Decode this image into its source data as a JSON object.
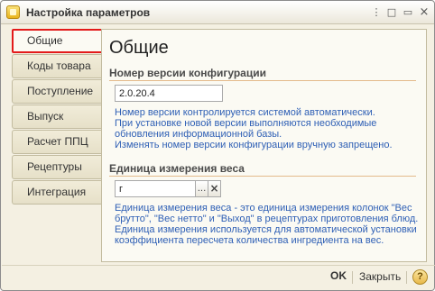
{
  "window": {
    "title": "Настройка параметров",
    "controls": {
      "more": "⋮",
      "minimize": "□",
      "maximize": "▭",
      "close": "×"
    }
  },
  "tabs": [
    {
      "label": "Общие",
      "active": true
    },
    {
      "label": "Коды товара"
    },
    {
      "label": "Поступление"
    },
    {
      "label": "Выпуск"
    },
    {
      "label": "Расчет ППЦ"
    },
    {
      "label": "Рецептуры"
    },
    {
      "label": "Интеграция"
    }
  ],
  "page": {
    "title": "Общие",
    "version_section": {
      "title": "Номер версии конфигурации",
      "value": "2.0.20.4",
      "info": [
        "Номер версии контролируется системой автоматически.",
        "При установке новой версии выполняются необходимые",
        "обновления информационной базы.",
        "Изменять номер версии конфигурации вручную запрещено."
      ]
    },
    "weight_section": {
      "title": "Единица измерения веса",
      "value": "г",
      "select_button": "...",
      "clear_button": "×",
      "info": [
        "Единица измерения веса - это единица измерения колонок \"Вес",
        "брутто\", \"Вес нетто\" и \"Выход\" в рецептурах приготовления блюд.",
        "Единица измерения используется для автоматической установки",
        "коэффициента пересчета количества ингредиента на вес."
      ]
    }
  },
  "footer": {
    "ok_label": "OK",
    "close_label": "Закрыть",
    "help_label": "?"
  },
  "colors": {
    "info_text": "#2e5fb5",
    "active_tab_border": "#e31a1a",
    "section_line": "#e4b98a"
  }
}
